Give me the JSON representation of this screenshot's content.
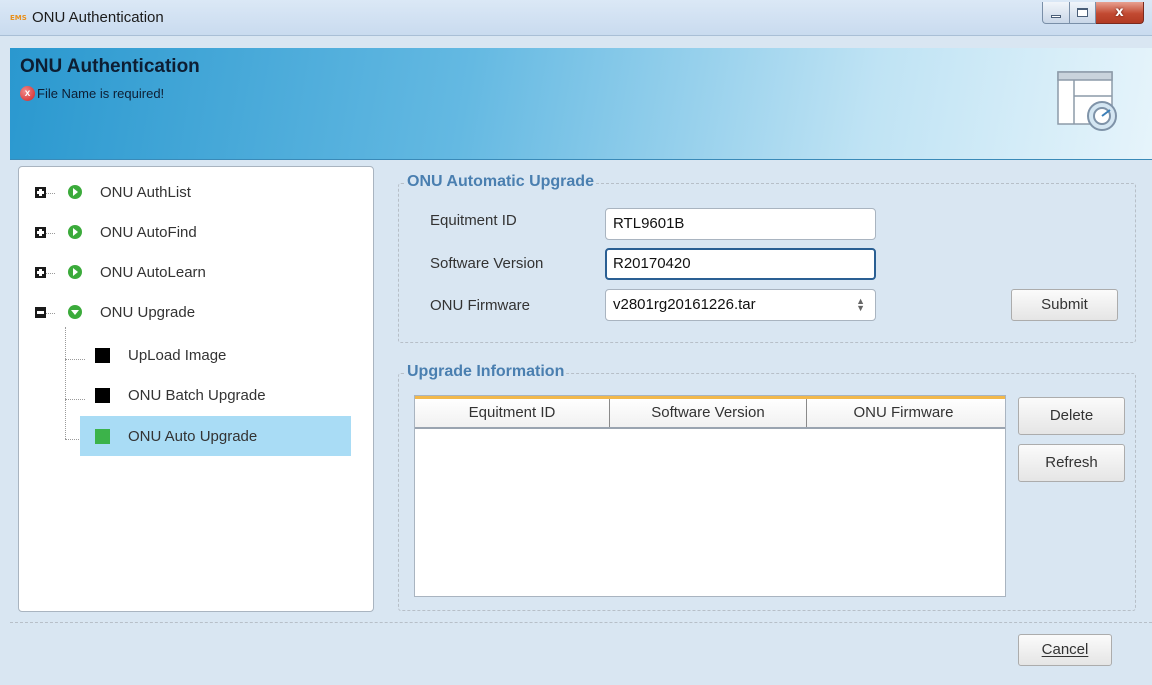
{
  "window": {
    "app_icon_text": "EMS",
    "title": "ONU Authentication",
    "close_glyph": "x"
  },
  "banner": {
    "title": "ONU Authentication",
    "error_message": "File Name is required!",
    "error_icon": "x"
  },
  "tree": {
    "nodes": [
      {
        "label": "ONU AuthList",
        "icon": "play-circle-icon",
        "expanded": false
      },
      {
        "label": "ONU AutoFind",
        "icon": "play-circle-icon",
        "expanded": false
      },
      {
        "label": "ONU AutoLearn",
        "icon": "play-circle-icon",
        "expanded": false
      },
      {
        "label": "ONU Upgrade",
        "icon": "down-circle-icon",
        "expanded": true
      }
    ],
    "children": [
      {
        "label": "UpLoad Image",
        "color": "#000000"
      },
      {
        "label": "ONU Batch Upgrade",
        "color": "#000000"
      },
      {
        "label": "ONU Auto Upgrade",
        "color": "#3cb34a",
        "selected": true
      }
    ]
  },
  "auto_upgrade": {
    "title": "ONU Automatic Upgrade",
    "equipment_id_label": "Equitment ID",
    "equipment_id_value": "RTL9601B",
    "software_version_label": "Software Version",
    "software_version_value": "R20170420",
    "firmware_label": "ONU Firmware",
    "firmware_value": "v2801rg20161226.tar",
    "submit_label": "Submit"
  },
  "upgrade_info": {
    "title": "Upgrade Information",
    "columns": [
      "Equitment ID",
      "Software Version",
      "ONU Firmware"
    ],
    "rows": [],
    "delete_label": "Delete",
    "refresh_label": "Refresh"
  },
  "footer": {
    "cancel_label": "Cancel"
  },
  "colors": {
    "accent": "#4a7fb0",
    "selection": "#a9dcf5",
    "table_header_top": "#f2b84b"
  }
}
